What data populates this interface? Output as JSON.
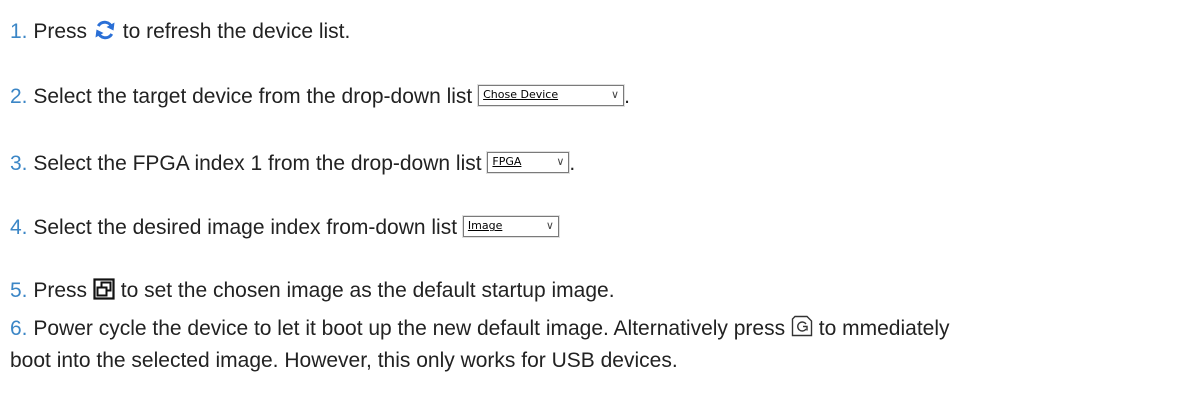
{
  "steps": [
    {
      "num": "1.",
      "before": "Press",
      "after": "to refresh the device list.",
      "icon": "refresh-icon"
    },
    {
      "num": "2.",
      "before": "Select the target device from the drop-down list",
      "combo": "Chose Device",
      "after": "."
    },
    {
      "num": "3.",
      "before": "Select the FPGA index 1 from the drop-down list",
      "combo": "FPGA",
      "after": "."
    },
    {
      "num": "4.",
      "before": "Select the desired image index from-down list",
      "combo": "Image",
      "after": ""
    },
    {
      "num": "5.",
      "before": "Press",
      "after": "to set the chosen image as the default startup image.",
      "icon": "set-default-icon"
    },
    {
      "num": "6.",
      "before": "Power cycle the device to let it boot up the new default image. Alternatively press",
      "after": "to mmediately",
      "continuation": "boot into the selected image. However, this only works for USB devices.",
      "icon": "boot-icon"
    }
  ],
  "colors": {
    "number": "#3b86c6",
    "refresh_icon": "#2a6fd6",
    "text": "#222222"
  },
  "chevron_glyph": "∨"
}
